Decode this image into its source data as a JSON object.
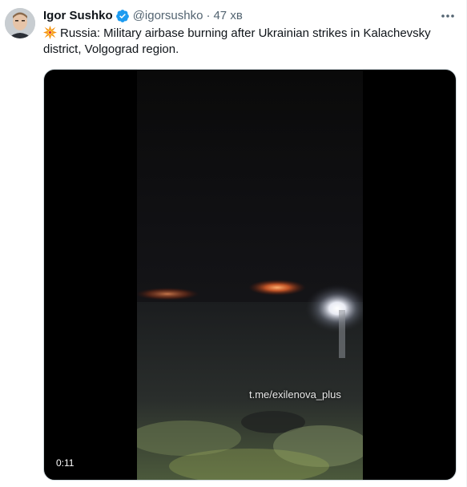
{
  "tweet": {
    "author_name": "Igor Sushko",
    "handle": "@igorsushko",
    "separator": "·",
    "time": "47 хв",
    "emoji_icon": "collision-icon",
    "text": "Russia: Military airbase burning after Ukrainian strikes in Kalachevsky district, Volgograd region.",
    "verified_color": "#1d9bf0"
  },
  "media": {
    "watermark": "t.me/exilenova_plus",
    "duration": "0:11"
  }
}
